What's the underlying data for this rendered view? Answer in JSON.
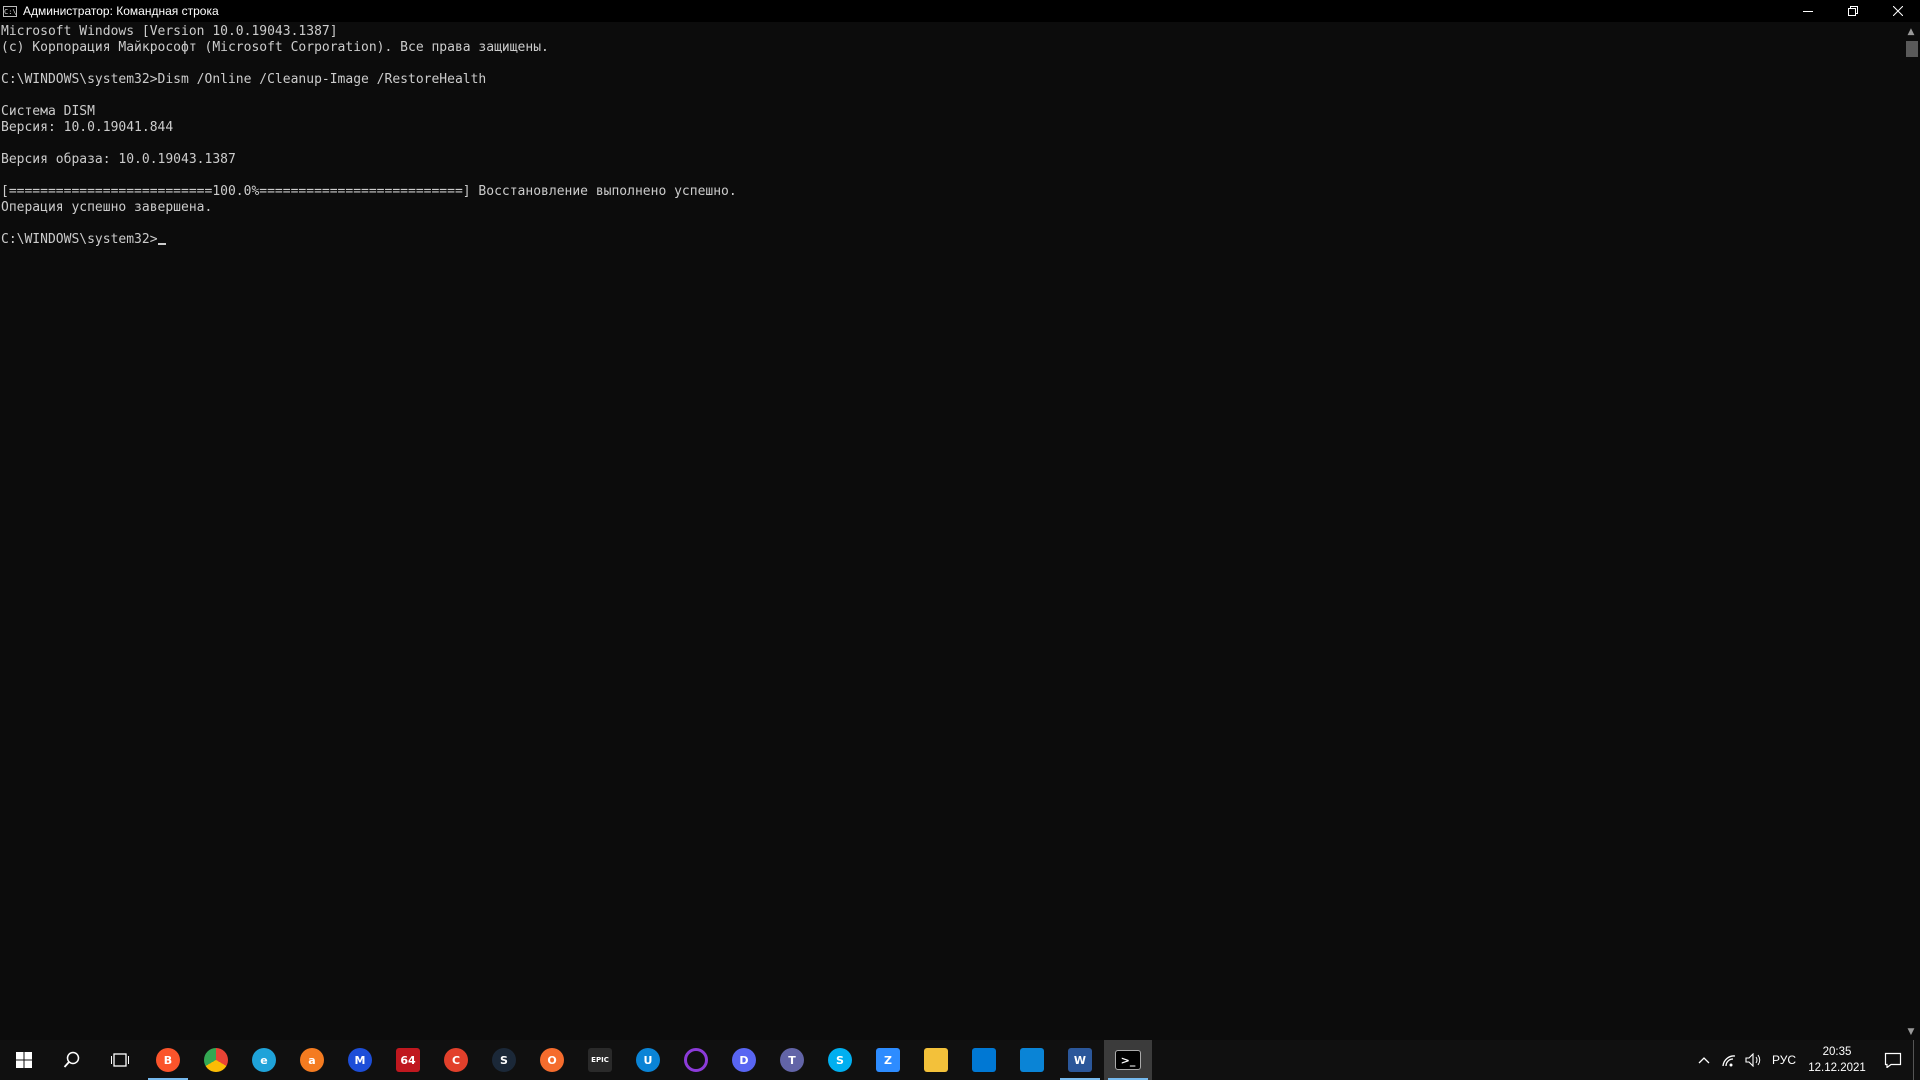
{
  "window": {
    "title": "Администратор: Командная строка",
    "icon_text": "C:\\",
    "buttons": [
      "minimize-icon",
      "restore-icon",
      "close-icon"
    ]
  },
  "console": {
    "lines": [
      "Microsoft Windows [Version 10.0.19043.1387]",
      "(c) Корпорация Майкрософт (Microsoft Corporation). Все права защищены.",
      "",
      "C:\\WINDOWS\\system32>Dism /Online /Cleanup-Image /RestoreHealth",
      "",
      "Система DISM",
      "Версия: 10.0.19041.844",
      "",
      "Версия образа: 10.0.19043.1387",
      "",
      "[==========================100.0%==========================] Восстановление выполнено успешно.",
      "Операция успешно завершена.",
      "",
      "C:\\WINDOWS\\system32>"
    ],
    "text_color": "#cccccc",
    "background": "#0c0c0c"
  },
  "taskbar": {
    "pinned": [
      {
        "name": "brave",
        "label": "B",
        "color": "#fb542b"
      },
      {
        "name": "chrome",
        "label": "",
        "color": "#4285f4"
      },
      {
        "name": "edge",
        "label": "e",
        "color": "#1fa3d9"
      },
      {
        "name": "avast",
        "label": "a",
        "color": "#f47b20"
      },
      {
        "name": "malwarebytes",
        "label": "M",
        "color": "#1d4ed8"
      },
      {
        "name": "aida64",
        "label": "64",
        "color": "#c0181f"
      },
      {
        "name": "ccleaner",
        "label": "C",
        "color": "#e2402b"
      },
      {
        "name": "steam",
        "label": "S",
        "color": "#1b2838"
      },
      {
        "name": "origin",
        "label": "O",
        "color": "#f56c2d"
      },
      {
        "name": "epic-games",
        "label": "EPIC",
        "color": "#2a2a2a"
      },
      {
        "name": "uplay",
        "label": "U",
        "color": "#0a84d6"
      },
      {
        "name": "cortana",
        "label": "",
        "color": "#8c3bd9"
      },
      {
        "name": "discord",
        "label": "D",
        "color": "#5865f2"
      },
      {
        "name": "teams",
        "label": "T",
        "color": "#6264a7"
      },
      {
        "name": "skype",
        "label": "S",
        "color": "#00aff0"
      },
      {
        "name": "zoom",
        "label": "Z",
        "color": "#2d8cff"
      },
      {
        "name": "file-explorer",
        "label": "",
        "color": "#f3c13a"
      },
      {
        "name": "microsoft-store",
        "label": "",
        "color": "#0078d4"
      },
      {
        "name": "mail",
        "label": "",
        "color": "#0a84d6"
      },
      {
        "name": "word",
        "label": "W",
        "color": "#2b579a"
      },
      {
        "name": "command-prompt",
        "label": ">_",
        "color": "#000000"
      }
    ],
    "tray": {
      "language": "РУС",
      "time": "20:35",
      "date": "12.12.2021"
    },
    "accent": "#76b9ed"
  }
}
